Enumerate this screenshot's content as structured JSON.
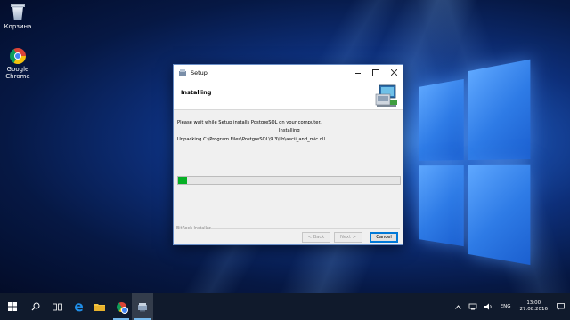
{
  "desktop": {
    "icons": [
      {
        "label": "Корзина",
        "icon": "recycle-bin-icon"
      },
      {
        "label": "Google Chrome",
        "icon": "chrome-icon"
      }
    ]
  },
  "window": {
    "title": "Setup",
    "header_heading": "Installing",
    "message": "Please wait while Setup installs PostgreSQL on your computer.",
    "status": "Installing",
    "detail": "Unpacking C:\\Program Files\\PostgreSQL\\9.3\\lib\\ascii_and_mic.dll",
    "progress": 0.04,
    "branding": "BitRock Installer",
    "buttons": {
      "back": "< Back",
      "next": "Next >",
      "cancel": "Cancel"
    }
  },
  "taskbar": {
    "pinned": [
      "windows-start-icon",
      "search-icon",
      "task-view-icon",
      "edge-icon",
      "file-explorer-icon",
      "chrome-icon",
      "setup-app-icon"
    ],
    "language": "ENG",
    "time": "13:00",
    "date": "27.08.2016"
  },
  "colors": {
    "progress": "#06b025",
    "taskbar": "#101a2c",
    "accent": "#0078d7"
  }
}
